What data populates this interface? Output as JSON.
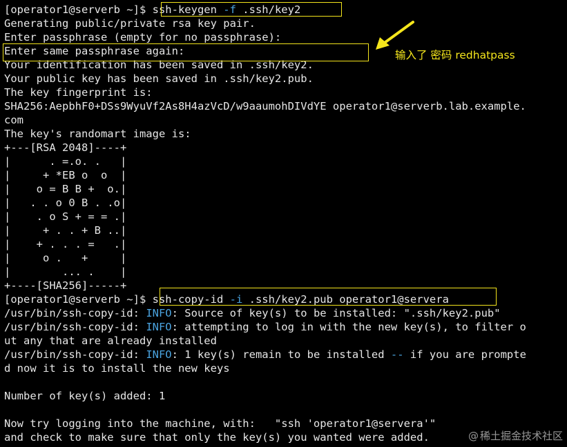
{
  "lines": [
    {
      "segs": [
        {
          "t": "[operator1@serverb ~]$ "
        },
        {
          "t": "ssh-keygen "
        },
        {
          "t": "-f",
          "c": "flag"
        },
        {
          "t": " .ssh/key2"
        }
      ]
    },
    {
      "segs": [
        {
          "t": "Generating public/private rsa key pair."
        }
      ]
    },
    {
      "segs": [
        {
          "t": "Enter passphrase (empty for no passphrase):"
        }
      ]
    },
    {
      "segs": [
        {
          "t": "Enter same passphrase again:"
        }
      ]
    },
    {
      "segs": [
        {
          "t": "Your identification has been saved in .ssh/key2."
        }
      ]
    },
    {
      "segs": [
        {
          "t": "Your public key has been saved in .ssh/key2.pub."
        }
      ]
    },
    {
      "segs": [
        {
          "t": "The key fingerprint is:"
        }
      ]
    },
    {
      "segs": [
        {
          "t": "SHA256:AepbhF0+DSs9WyuVf2As8H4azVcD/w9aaumohDIVdYE operator1@serverb.lab.example."
        }
      ]
    },
    {
      "segs": [
        {
          "t": "com"
        }
      ]
    },
    {
      "segs": [
        {
          "t": "The key's randomart image is:"
        }
      ]
    },
    {
      "segs": [
        {
          "t": "+---[RSA 2048]----+"
        }
      ]
    },
    {
      "segs": [
        {
          "t": "|      . =.o. .   |"
        }
      ]
    },
    {
      "segs": [
        {
          "t": "|     + *EB o  o  |"
        }
      ]
    },
    {
      "segs": [
        {
          "t": "|    o = B B +  o.|"
        }
      ]
    },
    {
      "segs": [
        {
          "t": "|   . . o 0 B . .o|"
        }
      ]
    },
    {
      "segs": [
        {
          "t": "|    . o S + = = .|"
        }
      ]
    },
    {
      "segs": [
        {
          "t": "|     + . . + B ..|"
        }
      ]
    },
    {
      "segs": [
        {
          "t": "|    + . . . =   .|"
        }
      ]
    },
    {
      "segs": [
        {
          "t": "|     o .   +     |"
        }
      ]
    },
    {
      "segs": [
        {
          "t": "|        ... .    |"
        }
      ]
    },
    {
      "segs": [
        {
          "t": "+----[SHA256]-----+"
        }
      ]
    },
    {
      "segs": [
        {
          "t": "[operator1@serverb ~]$ "
        },
        {
          "t": "ssh-copy-id "
        },
        {
          "t": "-i",
          "c": "flag"
        },
        {
          "t": " .ssh/key2.pub operator1@servera"
        }
      ]
    },
    {
      "segs": [
        {
          "t": "/usr/bin/ssh-copy-id: "
        },
        {
          "t": "INFO",
          "c": "info"
        },
        {
          "t": ": Source of key(s) to be installed: \".ssh/key2.pub\""
        }
      ]
    },
    {
      "segs": [
        {
          "t": "/usr/bin/ssh-copy-id: "
        },
        {
          "t": "INFO",
          "c": "info"
        },
        {
          "t": ": attempting to log in with the new key(s), to filter o"
        }
      ]
    },
    {
      "segs": [
        {
          "t": "ut any that are already installed"
        }
      ]
    },
    {
      "segs": [
        {
          "t": "/usr/bin/ssh-copy-id: "
        },
        {
          "t": "INFO",
          "c": "info"
        },
        {
          "t": ": 1 key(s) remain to be installed "
        },
        {
          "t": "--",
          "c": "dash"
        },
        {
          "t": " if you are prompte"
        }
      ]
    },
    {
      "segs": [
        {
          "t": "d now it is to install the new keys"
        }
      ]
    },
    {
      "segs": [
        {
          "t": ""
        }
      ]
    },
    {
      "segs": [
        {
          "t": "Number of key(s) added: 1"
        }
      ]
    },
    {
      "segs": [
        {
          "t": ""
        }
      ]
    },
    {
      "segs": [
        {
          "t": "Now try logging into the machine, with:   \"ssh 'operator1@servera'\""
        }
      ]
    },
    {
      "segs": [
        {
          "t": "and check to make sure that only the key(s) you wanted were added."
        }
      ]
    }
  ],
  "annotation": {
    "text": "输入了 密码 redhatpass"
  },
  "watermark": {
    "at": "@",
    "text": "稀土掘金技术社区"
  },
  "colors": {
    "background": "#000000",
    "text": "#e6e6e6",
    "accent_blue": "#4aa3df",
    "highlight_yellow": "#f5e61c"
  }
}
